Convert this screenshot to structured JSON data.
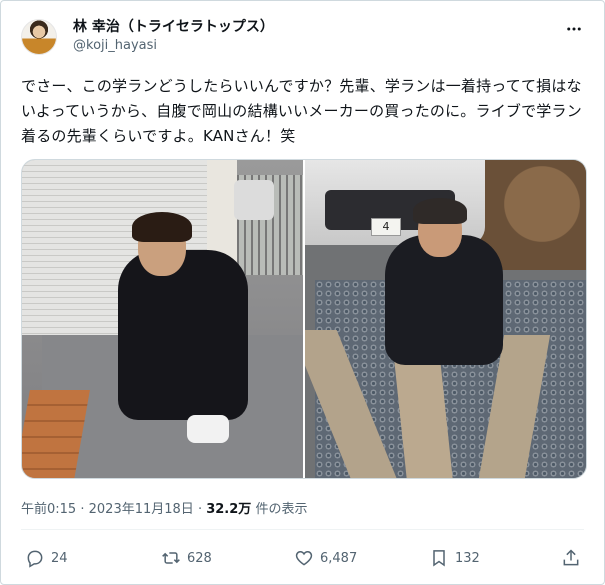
{
  "author": {
    "display_name": "林 幸治（トライセラトップス）",
    "handle": "@koji_hayasi"
  },
  "tweet": {
    "text": "でさー、この学ランどうしたらいいんですか？先輩、学ランは一着持ってて損はないよっていうから、自腹で岡山の結構いいメーカーの買ったのに。ライブで学ラン着るの先輩くらいですよ。KANさん！笑"
  },
  "media": {
    "count": 2,
    "right_plate_text": "4"
  },
  "meta": {
    "time": "午前0:15",
    "separator": "·",
    "date": "2023年11月18日",
    "views_count": "32.2万",
    "views_label": "件の表示"
  },
  "actions": {
    "replies": "24",
    "retweets": "628",
    "likes": "6,487",
    "bookmarks": "132"
  },
  "icons": {
    "more": "more-icon",
    "reply": "reply-icon",
    "retweet": "retweet-icon",
    "like": "heart-icon",
    "bookmark": "bookmark-icon",
    "share": "share-icon"
  },
  "colors": {
    "text_primary": "#0f1419",
    "text_secondary": "#536471",
    "border": "#cfd9de"
  }
}
